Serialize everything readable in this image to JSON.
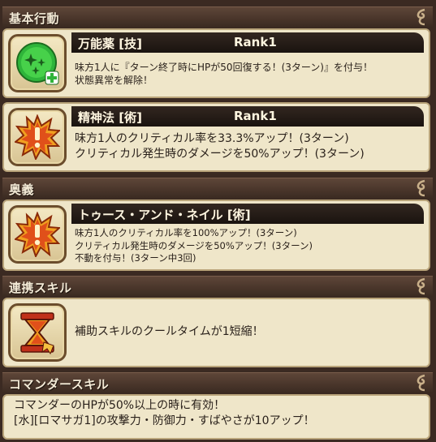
{
  "sections": {
    "basic": {
      "title": "基本行動"
    },
    "ougi": {
      "title": "奥義"
    },
    "renkei": {
      "title": "連携スキル"
    },
    "commander": {
      "title": "コマンダースキル"
    }
  },
  "skills": [
    {
      "name": "万能薬 [技]",
      "rank": "Rank1",
      "icon": "green-sparkle-heal-icon",
      "lines": [
        "味方1人に『ターン終了時にHPが50回復する！(3ターン)』を付与！",
        "状態異常を解除！"
      ]
    },
    {
      "name": "精神法 [術]",
      "rank": "Rank1",
      "icon": "critical-burst-icon",
      "lines": [
        "味方1人のクリティカル率を33.3%アップ！(3ターン)",
        "クリティカル発生時のダメージを50%アップ！(3ターン)"
      ]
    },
    {
      "name": "トゥース・アンド・ネイル [術]",
      "rank": "",
      "icon": "critical-burst-icon",
      "lines": [
        "味方1人のクリティカル率を100%アップ！(3ターン)",
        "クリティカル発生時のダメージを50%アップ！(3ターン)",
        "不動を付与！(3ターン中3回)"
      ]
    }
  ],
  "renkei_skill": {
    "icon": "hourglass-icon",
    "text": "補助スキルのクールタイムが1短縮！"
  },
  "commander_skill": {
    "lines": [
      "コマンダーのHPが50%以上の時に有効！",
      "[水][ロマサガ1]の攻撃力・防御力・すばやさが10アップ！"
    ]
  },
  "colors": {
    "header_bg": "#4a362b",
    "card_bg": "#efe6c9",
    "name_bar": "#1f1712",
    "heal_green": "#35c23a",
    "burst_orange": "#e0501a"
  }
}
